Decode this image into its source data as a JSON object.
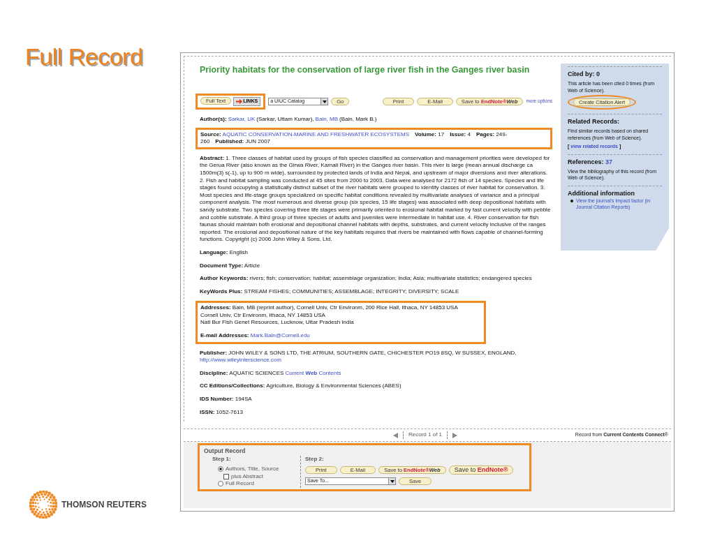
{
  "slide_title": "Full Record",
  "logo_text": "THOMSON REUTERS",
  "record": {
    "title": "Priority habitats for the conservation of large river fish in the Ganges river basin",
    "toolbar": {
      "full_text": "Full Text",
      "links": "LINKS",
      "catalog": "a UIUC Catalog",
      "go": "Go",
      "more": "more options",
      "buttons": [
        {
          "kind": "plain",
          "label": "Print"
        },
        {
          "kind": "plain",
          "label": "E-Mail"
        },
        {
          "kind": "endnote-web",
          "label": "Save to",
          "brand": "EndNote®",
          "suffix": "Web"
        }
      ]
    },
    "authors_label": "Author(s):",
    "authors": [
      {
        "short": "Sarkar, UK",
        "full": "(Sarkar, Uttam Kumar),"
      },
      {
        "short": "Bain, MB",
        "full": "(Bain, Mark B.)"
      }
    ],
    "source": {
      "label": "Source:",
      "journal": "AQUATIC CONSERVATION-MARINE AND FRESHWATER ECOSYSTEMS",
      "parts": [
        {
          "label": "Volume:",
          "value": "17"
        },
        {
          "label": "Issue:",
          "value": "4"
        },
        {
          "label": "Pages:",
          "value": "249-260"
        },
        {
          "label": "Published:",
          "value": "JUN 2007"
        }
      ]
    },
    "field_groups": [
      {
        "highlighted": false,
        "fields": [
          {
            "label": "Abstract:",
            "value": "1. Three classes of habitat used by groups of fish species classified as conservation and management priorities were developed for the Gerua River (also known as the Girwa River, Karnali River) in the Ganges river basin. This river is large (mean annual discharge ca 1500m(3) s(-1), up to 900 m wide), surrounded by protected lands of India and Nepal, and upstream of major diversions and river alterations. 2. Fish and habitat sampling was conducted at 45 sites from 2000 to 2003. Data were analysed for 2172 fish of 14 species. Species and life stages found occupying a statistically distinct subset of the river habitats were grouped to identify classes of river habitat for conservation. 3. Most species and life-stage groups specialized on specific habitat conditions revealed by multivariate analyses of variance and a principal component analysis. The most numerous and diverse group (six species, 15 life stages) was associated with deep depositional habitats with sandy substrate. Two species covering three life stages were primarily oriented to erosional habitat marked by fast current velocity with pebble and cobble substrate. A third group of three species of adults and juveniles were intermediate in habitat use. 4. River conservation for fish faunas should maintain both erosional and depositional channel habitats with depths, substrates, and current velocity inclusive of the ranges reported. The erosional and depositional nature of the key habitats requires that rivers be maintained with flows capable of channel-forming functions. Copyright (c) 2006 John Wiley & Sons, Ltd."
          },
          {
            "label": "Language:",
            "value": "English"
          },
          {
            "label": "Document Type:",
            "value": "Article"
          },
          {
            "label": "Author Keywords:",
            "value": "rivers; fish; conservation; habitat; assemblage organization; India; Asia; multivariate statistics; endangered species"
          },
          {
            "label": "KeyWords Plus:",
            "value": "STREAM FISHES; COMMUNITIES; ASSEMBLAGE; INTEGRITY; DIVERSITY; SCALE"
          }
        ]
      },
      {
        "highlighted": true,
        "fields": [
          {
            "label": "Addresses:",
            "lines": [
              "Bain, MB (reprint author), Cornell Univ, Ctr Environm, 200 Rice Hall, Ithaca, NY 14853 USA",
              "Cornell Univ, Ctr Environm, Ithaca, NY 14853 USA",
              "Natl Bur Fish Genet Resources, Lucknow, Uttar Pradesh India"
            ]
          },
          {
            "label": "E-mail Addresses:",
            "link": "Mark.Bain@Cornell.edu"
          }
        ]
      },
      {
        "highlighted": false,
        "fields": [
          {
            "label": "Publisher:",
            "value": "JOHN WILEY & SONS LTD, THE ATRIUM, SOUTHERN GATE, CHICHESTER PO19 8SQ, W SUSSEX, ENGLAND,",
            "link": "http://www.wileyinterscience.com"
          },
          {
            "label": "Discipline:",
            "value": "AQUATIC SCIENCES",
            "link": "Current **Web** Contents"
          },
          {
            "label": "CC Editions/Collections:",
            "value": "Agriculture, Biology & Environmental Sciences (ABES)"
          },
          {
            "label": "IDS Number:",
            "value": "194SA"
          },
          {
            "label": "ISSN:",
            "value": "1052-7613"
          }
        ]
      }
    ],
    "pager": {
      "text": "Record 1 of 1",
      "source": "Record from **Current Contents Connect**®"
    },
    "sidebar": [
      {
        "kind": "cited",
        "title": "Cited by: 0",
        "text": "This article has been cited 0 times (from Web of Science).",
        "button": "Create Citation Alert"
      },
      {
        "kind": "related",
        "title": "Related Records:",
        "text": "Find similar records based on shared references (from Web of Science).",
        "before": "[",
        "link": "view related records",
        "after": "]"
      },
      {
        "kind": "references",
        "title": "References:",
        "count": "37",
        "text": "View the bibliography of this record (from Web of Science)."
      },
      {
        "kind": "additional",
        "title": "Additional information",
        "items": [
          "View the journal's impact factor (in Journal Citation Reports)"
        ]
      }
    ],
    "output": {
      "title": "Output Record",
      "step1": "Step 1:",
      "step2": "Step 2:",
      "options": [
        {
          "kind": "radio",
          "label": "Authors, Title, Source",
          "selected": true
        },
        {
          "kind": "checkbox",
          "label": "plus Abstract",
          "checked": false
        },
        {
          "kind": "radio",
          "label": "Full Record",
          "selected": false
        }
      ],
      "buttons": [
        {
          "kind": "plain",
          "label": "Print"
        },
        {
          "kind": "plain",
          "label": "E-Mail"
        },
        {
          "kind": "endnote-web",
          "label": "Save to",
          "brand": "EndNote®",
          "suffix": "Web"
        },
        {
          "kind": "endnote",
          "label": "Save to",
          "brand": "EndNote®"
        }
      ],
      "select": "Save To...",
      "save": "Save"
    }
  }
}
